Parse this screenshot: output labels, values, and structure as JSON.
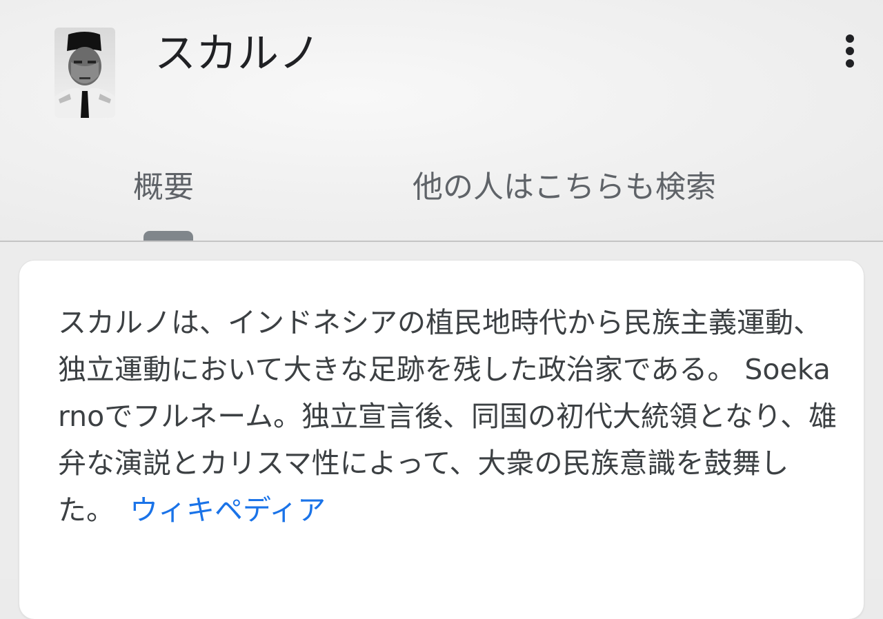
{
  "header": {
    "title": "スカルノ",
    "portrait_alt": "スカルノ"
  },
  "tabs": [
    {
      "label": "概要",
      "selected": true
    },
    {
      "label": "他の人はこちらも検索",
      "selected": false
    }
  ],
  "description": {
    "text": "スカルノは、インドネシアの植民地時代から民族主義運動、独立運動において大きな足跡を残した政治家である。 Soekarnoでフルネーム。独立宣言後、同国の初代大統領となり、雄弁な演説とカリスマ性によって、大衆の民族意識を鼓舞した。",
    "source_label": "ウィキペディア"
  },
  "colors": {
    "link": "#1a73e8",
    "text": "#3c4043",
    "title": "#202124"
  },
  "icons": {
    "more": "more-vert-icon"
  }
}
